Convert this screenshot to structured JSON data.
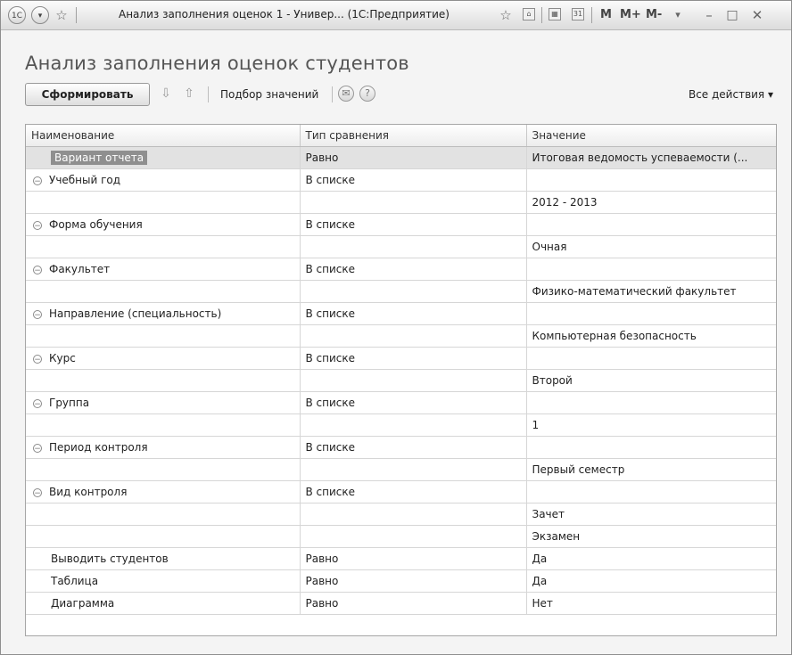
{
  "window": {
    "title": "Анализ заполнения оценок 1 - Универ... (1С:Предприятие)",
    "controls": [
      "М",
      "М+",
      "М-"
    ]
  },
  "page": {
    "title": "Анализ заполнения оценок студентов"
  },
  "toolbar": {
    "generate_label": "Сформировать",
    "select_values_label": "Подбор значений",
    "all_actions_label": "Все действия ▾"
  },
  "table": {
    "headers": [
      "Наименование",
      "Тип сравнения",
      "Значение"
    ],
    "rows": [
      {
        "name": "Вариант отчета",
        "cmp": "Равно",
        "value": "Итоговая ведомость успеваемости (...",
        "selected": true,
        "toggle": false
      },
      {
        "name": "Учебный год",
        "cmp": "В списке",
        "value": "",
        "toggle": true
      },
      {
        "name": "",
        "cmp": "",
        "value": "2012 - 2013",
        "toggle": false
      },
      {
        "name": "Форма обучения",
        "cmp": "В списке",
        "value": "",
        "toggle": true
      },
      {
        "name": "",
        "cmp": "",
        "value": "Очная",
        "toggle": false
      },
      {
        "name": "Факультет",
        "cmp": "В списке",
        "value": "",
        "toggle": true
      },
      {
        "name": "",
        "cmp": "",
        "value": "Физико-математический факультет",
        "toggle": false
      },
      {
        "name": "Направление (специальность)",
        "cmp": "В списке",
        "value": "",
        "toggle": true
      },
      {
        "name": "",
        "cmp": "",
        "value": "Компьютерная безопасность",
        "toggle": false
      },
      {
        "name": "Курс",
        "cmp": "В списке",
        "value": "",
        "toggle": true
      },
      {
        "name": "",
        "cmp": "",
        "value": "Второй",
        "toggle": false
      },
      {
        "name": "Группа",
        "cmp": "В списке",
        "value": "",
        "toggle": true
      },
      {
        "name": "",
        "cmp": "",
        "value": "1",
        "toggle": false
      },
      {
        "name": "Период контроля",
        "cmp": "В списке",
        "value": "",
        "toggle": true
      },
      {
        "name": "",
        "cmp": "",
        "value": "Первый семестр",
        "toggle": false
      },
      {
        "name": "Вид контроля",
        "cmp": "В списке",
        "value": "",
        "toggle": true
      },
      {
        "name": "",
        "cmp": "",
        "value": "Зачет",
        "toggle": false
      },
      {
        "name": "",
        "cmp": "",
        "value": "Экзамен",
        "toggle": false
      },
      {
        "name": "Выводить студентов",
        "cmp": "Равно",
        "value": "Да",
        "toggle": false
      },
      {
        "name": "Таблица",
        "cmp": "Равно",
        "value": "Да",
        "toggle": false
      },
      {
        "name": "Диаграмма",
        "cmp": "Равно",
        "value": "Нет",
        "toggle": false
      }
    ]
  }
}
